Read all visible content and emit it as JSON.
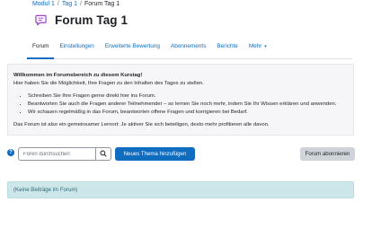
{
  "breadcrumb": {
    "item1": "Modul 1",
    "item2": "Tag 1",
    "current": "Forum Tag 1",
    "separator": "/"
  },
  "page": {
    "title": "Forum Tag 1",
    "icon": "forum-icon"
  },
  "nav": {
    "tabs": [
      {
        "label": "Forum",
        "active": true
      },
      {
        "label": "Einstellungen"
      },
      {
        "label": "Erweiterte Bewertung"
      },
      {
        "label": "Abonnements"
      },
      {
        "label": "Berichte"
      },
      {
        "label": "Mehr",
        "chevron": "▾"
      }
    ]
  },
  "intro": {
    "heading": "Willkommen im Forumsbereich zu diesem Kurstag!",
    "subheading": "Hier haben Sie die Möglichkeit, Ihre Fragen zu den Inhalten des Tages zu stellen.",
    "bullets": [
      "Schreiben Sie Ihre Fragen gerne direkt hier ins Forum.",
      "Beantworten Sie auch die Fragen anderer Teilnehmender – so lernen Sie noch mehr, indem Sie Ihr Wissen erklären und anwenden.",
      "Wir schauen regelmäßig in das Forum, beantworten offene Fragen und korrigieren bei Bedarf."
    ],
    "footer": "Das Forum ist also ein gemeinsamer Lernort: Je aktiver Sie sich beteiligen, desto mehr profitieren alle davon."
  },
  "controls": {
    "help_icon": "?",
    "search_placeholder": "Foren durchsuchen",
    "search_icon": "search-icon",
    "new_topic_label": "Neues Thema hinzufügen",
    "subscribe_label": "Forum abonnieren"
  },
  "empty_message": "(Keine Beiträge im Forum)",
  "colors": {
    "primary": "#0f6cbf",
    "forum_icon": "#9b3fd1",
    "alert_bg": "#cce6ea",
    "alert_text": "#2e6a74",
    "secondary_btn": "#ced4da"
  }
}
